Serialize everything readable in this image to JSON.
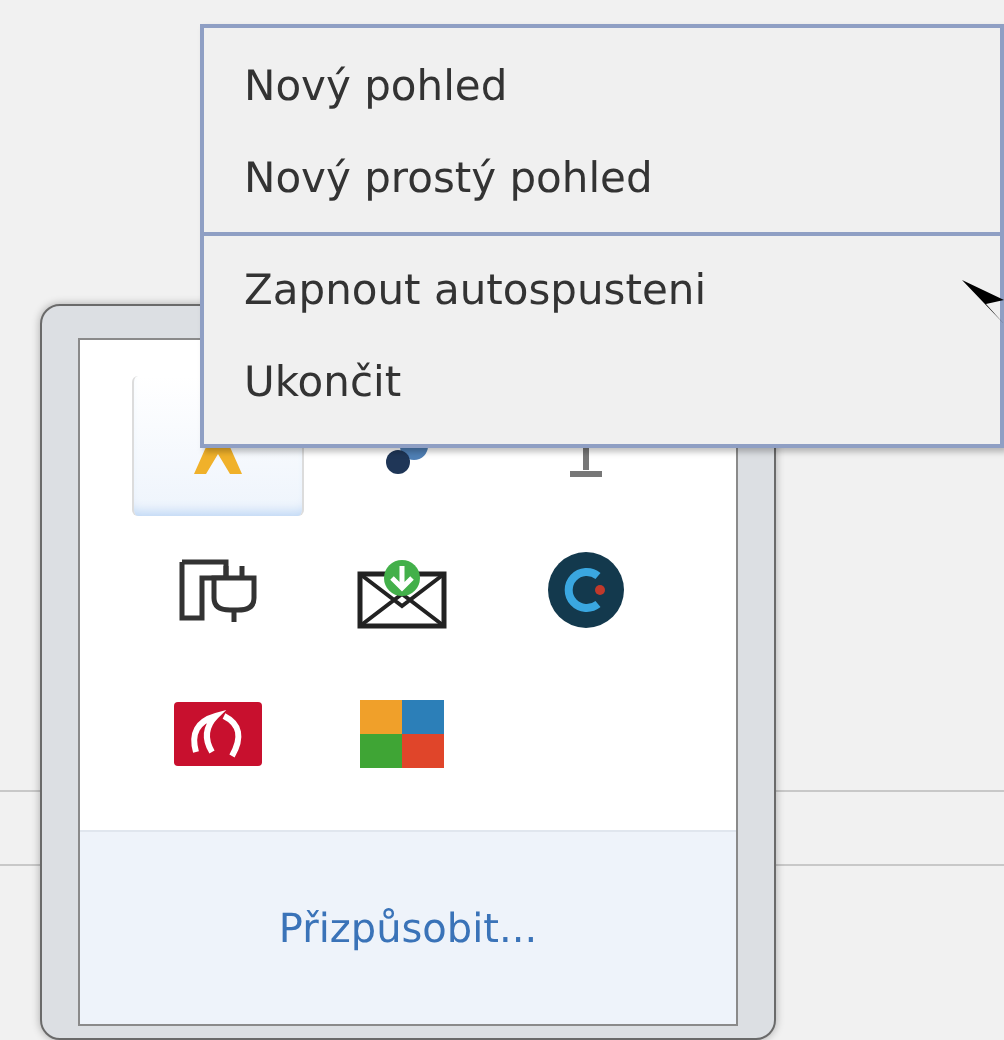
{
  "tray_popup": {
    "icons": [
      {
        "kind": "figure",
        "selected": true
      },
      {
        "kind": "cluster",
        "selected": false
      },
      {
        "kind": "antenna",
        "selected": false
      },
      {
        "kind": "plug",
        "selected": false
      },
      {
        "kind": "mail",
        "selected": false
      },
      {
        "kind": "disc",
        "selected": false
      },
      {
        "kind": "swirl",
        "selected": false
      },
      {
        "kind": "mosaic",
        "selected": false
      }
    ],
    "link": "Přizpůsobit..."
  },
  "context_menu": {
    "groups": [
      [
        "Nový pohled",
        "Nový prostý pohled"
      ],
      [
        "Zapnout autospusteni",
        "Ukončit"
      ]
    ]
  }
}
